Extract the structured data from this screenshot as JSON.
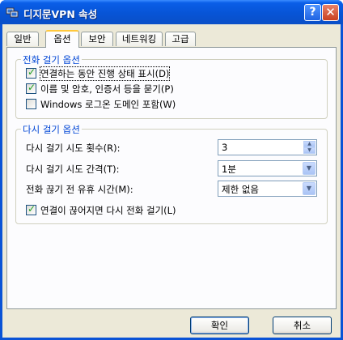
{
  "window": {
    "title": "디지문VPN 속성",
    "help_glyph": "?",
    "close_glyph": "✕"
  },
  "tabs": [
    {
      "label": "일반"
    },
    {
      "label": "옵션",
      "active": true
    },
    {
      "label": "보안"
    },
    {
      "label": "네트워킹"
    },
    {
      "label": "고급"
    }
  ],
  "dial_options": {
    "title": "전화 걸기 옵션",
    "items": [
      {
        "label": "연결하는 동안 진행 상태 표시(D)",
        "checked": true
      },
      {
        "label": "이름 및 암호, 인증서 등을 묻기(P)",
        "checked": true
      },
      {
        "label": "Windows 로그온 도메인 포함(W)",
        "checked": false
      }
    ]
  },
  "redial_options": {
    "title": "다시 걸기 옵션",
    "redial_attempts": {
      "label": "다시 걸기 시도 횟수(R):",
      "value": "3"
    },
    "redial_interval": {
      "label": "다시 걸기 시도 간격(T):",
      "value": "1분"
    },
    "idle_time": {
      "label": "전화 끊기 전 유휴 시간(M):",
      "value": "제한 없음"
    },
    "redial_if_dropped": {
      "label": "연결이 끊어지면 다시 전화 걸기(L)",
      "checked": true
    }
  },
  "buttons": {
    "ok": "확인",
    "cancel": "취소"
  },
  "colors": {
    "titlebar": "#0754d6",
    "group_title": "#0046d5",
    "check_mark": "#21a121"
  }
}
